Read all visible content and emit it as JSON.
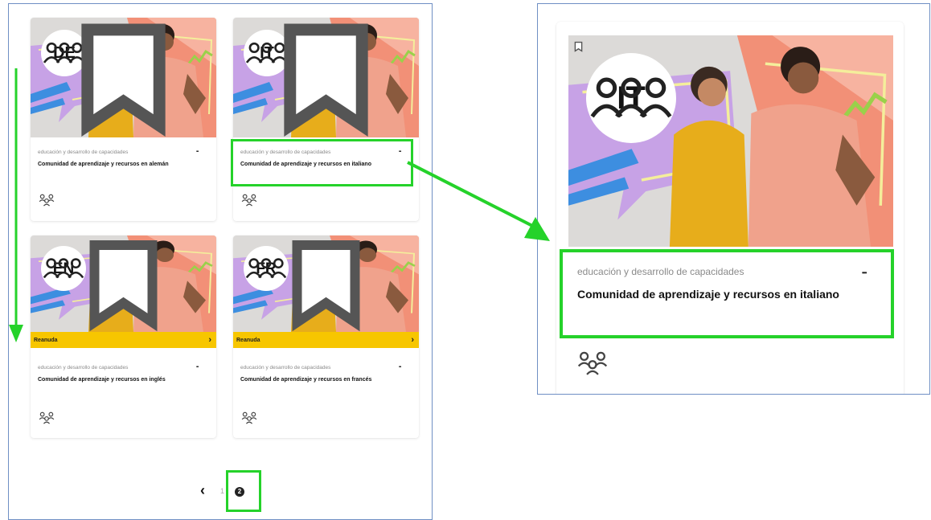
{
  "cards": [
    {
      "code": "DE",
      "category": "educación y desarrollo de capacidades",
      "title": "Comunidad de aprendizaje y recursos en alemán",
      "resume": ""
    },
    {
      "code": "IT",
      "category": "educación y desarrollo de capacidades",
      "title": "Comunidad de aprendizaje y recursos en italiano",
      "resume": ""
    },
    {
      "code": "EN",
      "category": "educación y desarrollo de capacidades",
      "title": "Comunidad de aprendizaje y recursos en inglés",
      "resume": "Reanuda"
    },
    {
      "code": "FR",
      "category": "educación y desarrollo de capacidades",
      "title": "Comunidad de aprendizaje y recursos en francés",
      "resume": "Reanuda"
    }
  ],
  "zoom_card": {
    "code": "IT",
    "category": "educación y desarrollo de capacidades",
    "title": "Comunidad de aprendizaje y recursos en italiano"
  },
  "more_label": "•••",
  "resume_arrow": "›",
  "pagination": {
    "prev": "‹",
    "pages": [
      "1",
      "2"
    ],
    "current": "2"
  },
  "colors": {
    "highlight": "#25d22a",
    "panel_border": "#6f8fc4",
    "resume_bar": "#f7c600"
  }
}
